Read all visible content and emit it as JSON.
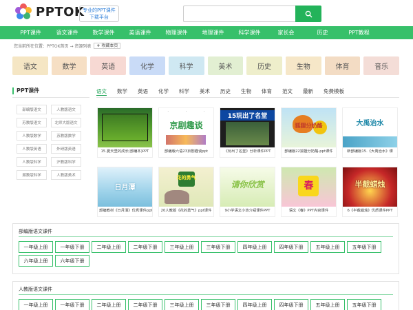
{
  "header": {
    "logo_text": "PPTOK",
    "slogan_line1": "专业的PPT课件",
    "slogan_line2": "下载平台",
    "search_placeholder": "",
    "search_icon": "search-icon",
    "accent": "#37c06a"
  },
  "nav": {
    "items": [
      "PPT课件",
      "语文课件",
      "数学课件",
      "英语课件",
      "物理课件",
      "地理课件",
      "科学课件",
      "家长会",
      "历史",
      "PPT教程"
    ]
  },
  "breadcrumb": {
    "text": "您当前所在位置：PPTOK首页 → 资源列表",
    "fav_label": "收藏本页"
  },
  "subjects": [
    {
      "label": "语文",
      "bg": "#f5e6c4"
    },
    {
      "label": "数学",
      "bg": "#f6dfc4"
    },
    {
      "label": "英语",
      "bg": "#f7d9d3"
    },
    {
      "label": "化学",
      "bg": "#c9dbf7"
    },
    {
      "label": "科学",
      "bg": "#cfe8f2"
    },
    {
      "label": "美术",
      "bg": "#e2efd2"
    },
    {
      "label": "历史",
      "bg": "#eeeecb"
    },
    {
      "label": "生物",
      "bg": "#f6e7c8"
    },
    {
      "label": "体育",
      "bg": "#f3dcc4"
    },
    {
      "label": "音乐",
      "bg": "#f4ddd7"
    }
  ],
  "left": {
    "title": "PPT课件",
    "items": [
      "部编版语文",
      "人教版语文",
      "苏教版语文",
      "北师大版语文",
      "人教版数学",
      "苏教版数学",
      "人教版英语",
      "外研版英语",
      "人教版科学",
      "沪教版科学",
      "湘教版科学",
      "人教版美术"
    ]
  },
  "tabs": {
    "items": [
      "语文",
      "数学",
      "英语",
      "化学",
      "科学",
      "美术",
      "历史",
      "生物",
      "体育",
      "范文",
      "最新",
      "免费模板"
    ],
    "active_index": 0
  },
  "thumbs": [
    {
      "caption": "15.夏天里的成长(部编本)PPT",
      "art": "rice",
      "art_text": ""
    },
    {
      "caption": "部编版六语23京剧趣谈ppt",
      "art": "opera",
      "art_text": "京剧趣谈"
    },
    {
      "caption": "《玩出了名堂》分析课件PPT",
      "art": "play",
      "art_text": "15玩出了名堂"
    },
    {
      "caption": "部编版22狐狸分奶酪-ppt课件",
      "art": "fox",
      "art_text": "狐狸分奶酪"
    },
    {
      "caption": "新部编版15.《大禹治水》课",
      "art": "yu",
      "art_text": "大禹治水"
    },
    {
      "caption": "部编教材《日月潭》优秀课件ppt",
      "art": "lake",
      "art_text": "日月潭"
    },
    {
      "caption": "20人教版《花的勇气》ppt课件",
      "art": "flower",
      "art_text": "花的勇气"
    },
    {
      "caption": "9小学语文小池介绍课件PPT",
      "art": "pond",
      "art_text": "请你欣赏"
    },
    {
      "caption": "语文《春》PPT内容课件",
      "art": "spring",
      "art_text": "春"
    },
    {
      "caption": "6《半截蜡烛》优质课件PPT",
      "art": "candle",
      "art_text": "半截蜡烛"
    }
  ],
  "sections": [
    {
      "title": "部编版语文课件",
      "grades": [
        "一年级上册",
        "一年级下册",
        "二年级上册",
        "二年级下册",
        "三年级上册",
        "三年级下册",
        "四年级上册",
        "四年级下册",
        "五年级上册",
        "五年级下册",
        "六年级上册",
        "六年级下册"
      ]
    },
    {
      "title": "人教版语文课件",
      "grades": [
        "一年级上册",
        "一年级下册",
        "二年级上册",
        "二年级下册",
        "三年级上册",
        "三年级下册",
        "四年级上册",
        "四年级下册",
        "五年级上册",
        "五年级下册"
      ]
    }
  ]
}
